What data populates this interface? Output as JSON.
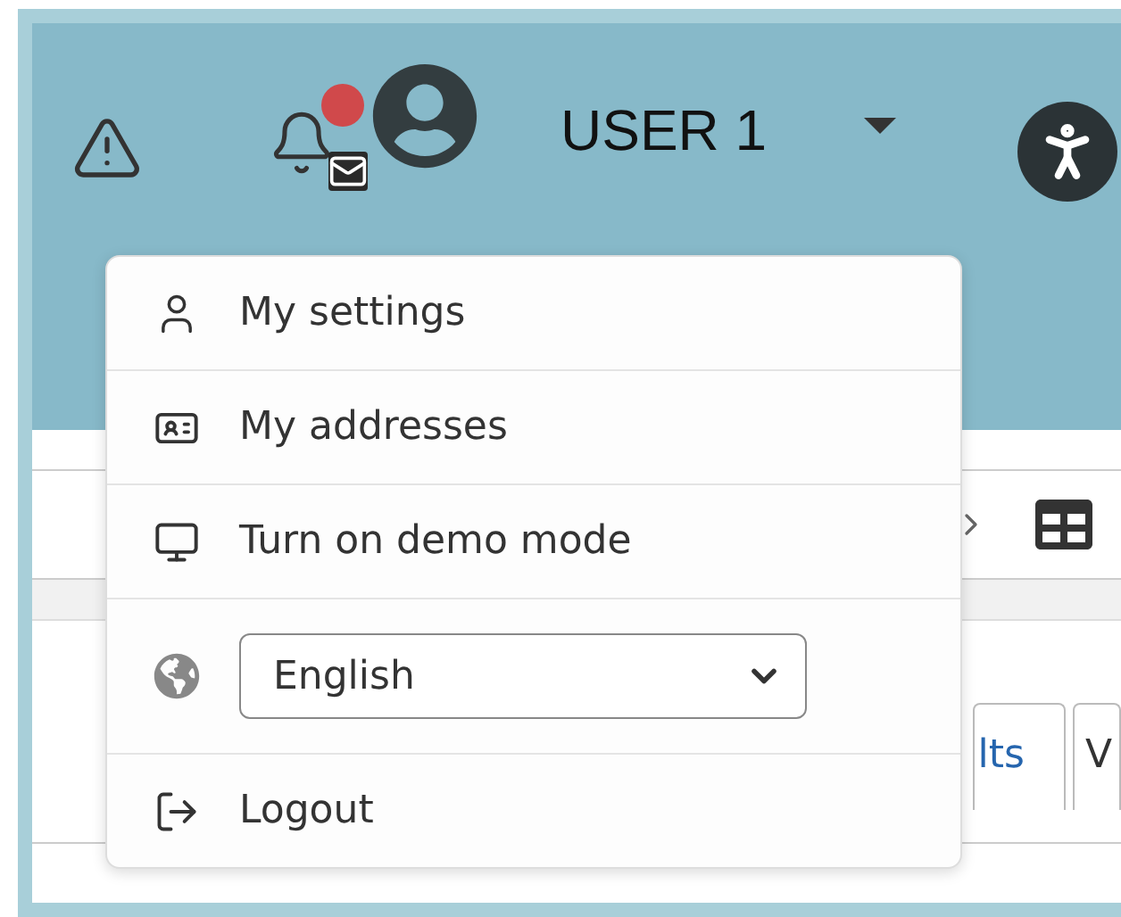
{
  "header": {
    "user_name": "USER 1"
  },
  "menu": {
    "items": [
      {
        "kind": "link",
        "label": "My settings"
      },
      {
        "kind": "link",
        "label": "My addresses"
      },
      {
        "kind": "link",
        "label": "Turn on demo mode"
      },
      {
        "kind": "select",
        "value": "English"
      },
      {
        "kind": "link",
        "label": "Logout"
      }
    ]
  },
  "tabs": [
    {
      "label": "lts"
    },
    {
      "label": "V"
    }
  ]
}
